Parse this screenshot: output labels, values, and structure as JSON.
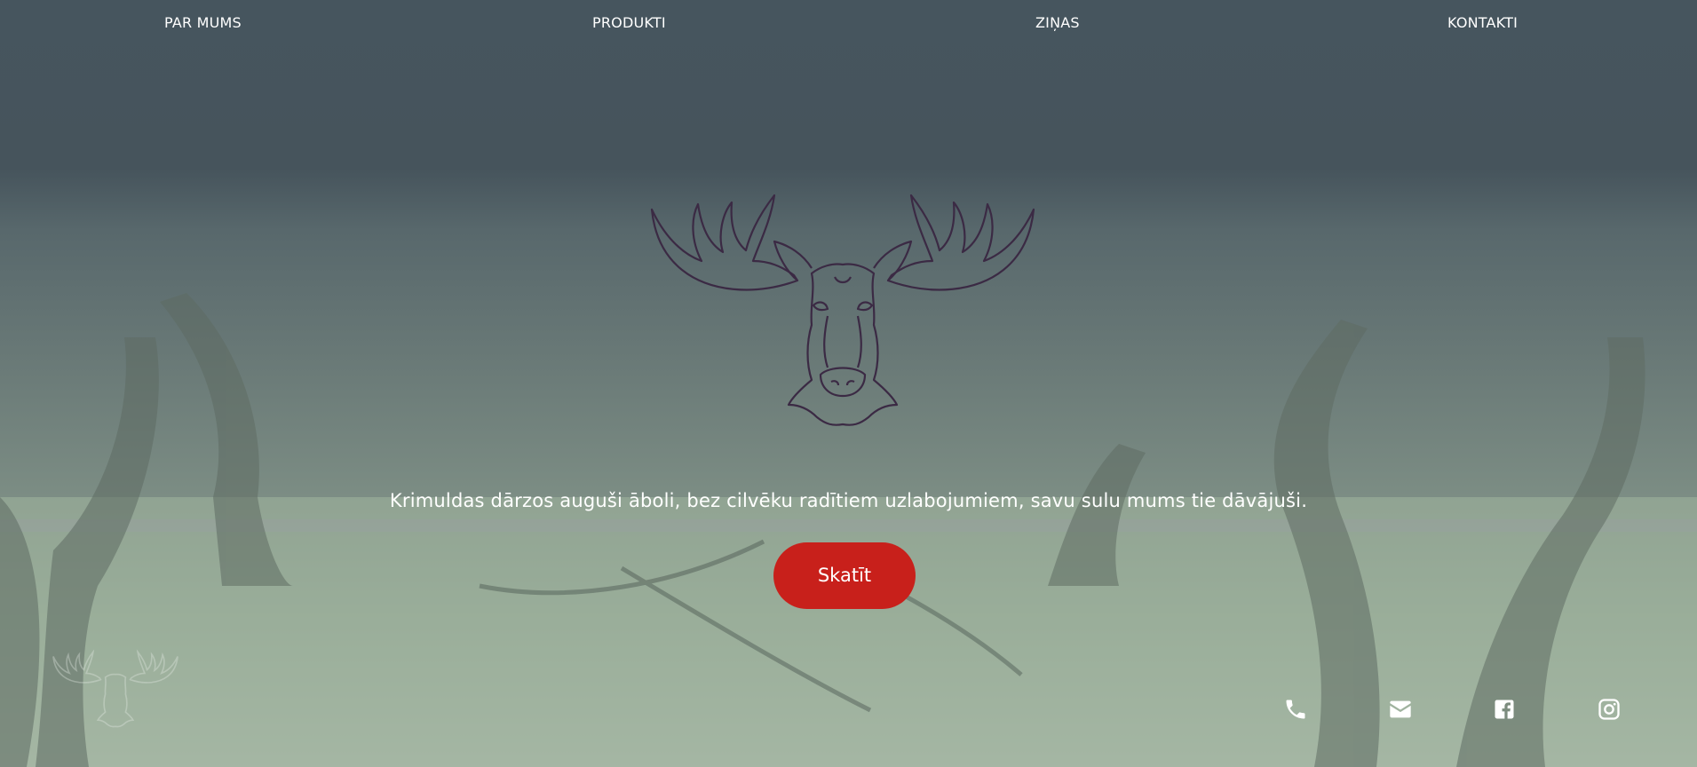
{
  "nav": {
    "items": [
      {
        "label": "PAR MUMS"
      },
      {
        "label": "PRODUKTI"
      },
      {
        "label": "ZIŅAS"
      },
      {
        "label": "KONTAKTI"
      }
    ]
  },
  "hero": {
    "logo_icon": "moose-head-logo-icon",
    "tagline": "Krimuldas dārzos auguši āboli, bez cilvēku radītiem uzlabojumiem, savu sulu mums tie dāvājuši.",
    "cta_label": "Skatīt"
  },
  "footer": {
    "corner_logo_icon": "moose-head-logo-icon",
    "social": [
      {
        "icon": "phone-icon"
      },
      {
        "icon": "mail-icon"
      },
      {
        "icon": "facebook-icon"
      },
      {
        "icon": "instagram-icon"
      }
    ]
  },
  "colors": {
    "accent": "#c8201b",
    "logo_stroke": "#3b2a44",
    "nav_text": "#ffffff"
  }
}
